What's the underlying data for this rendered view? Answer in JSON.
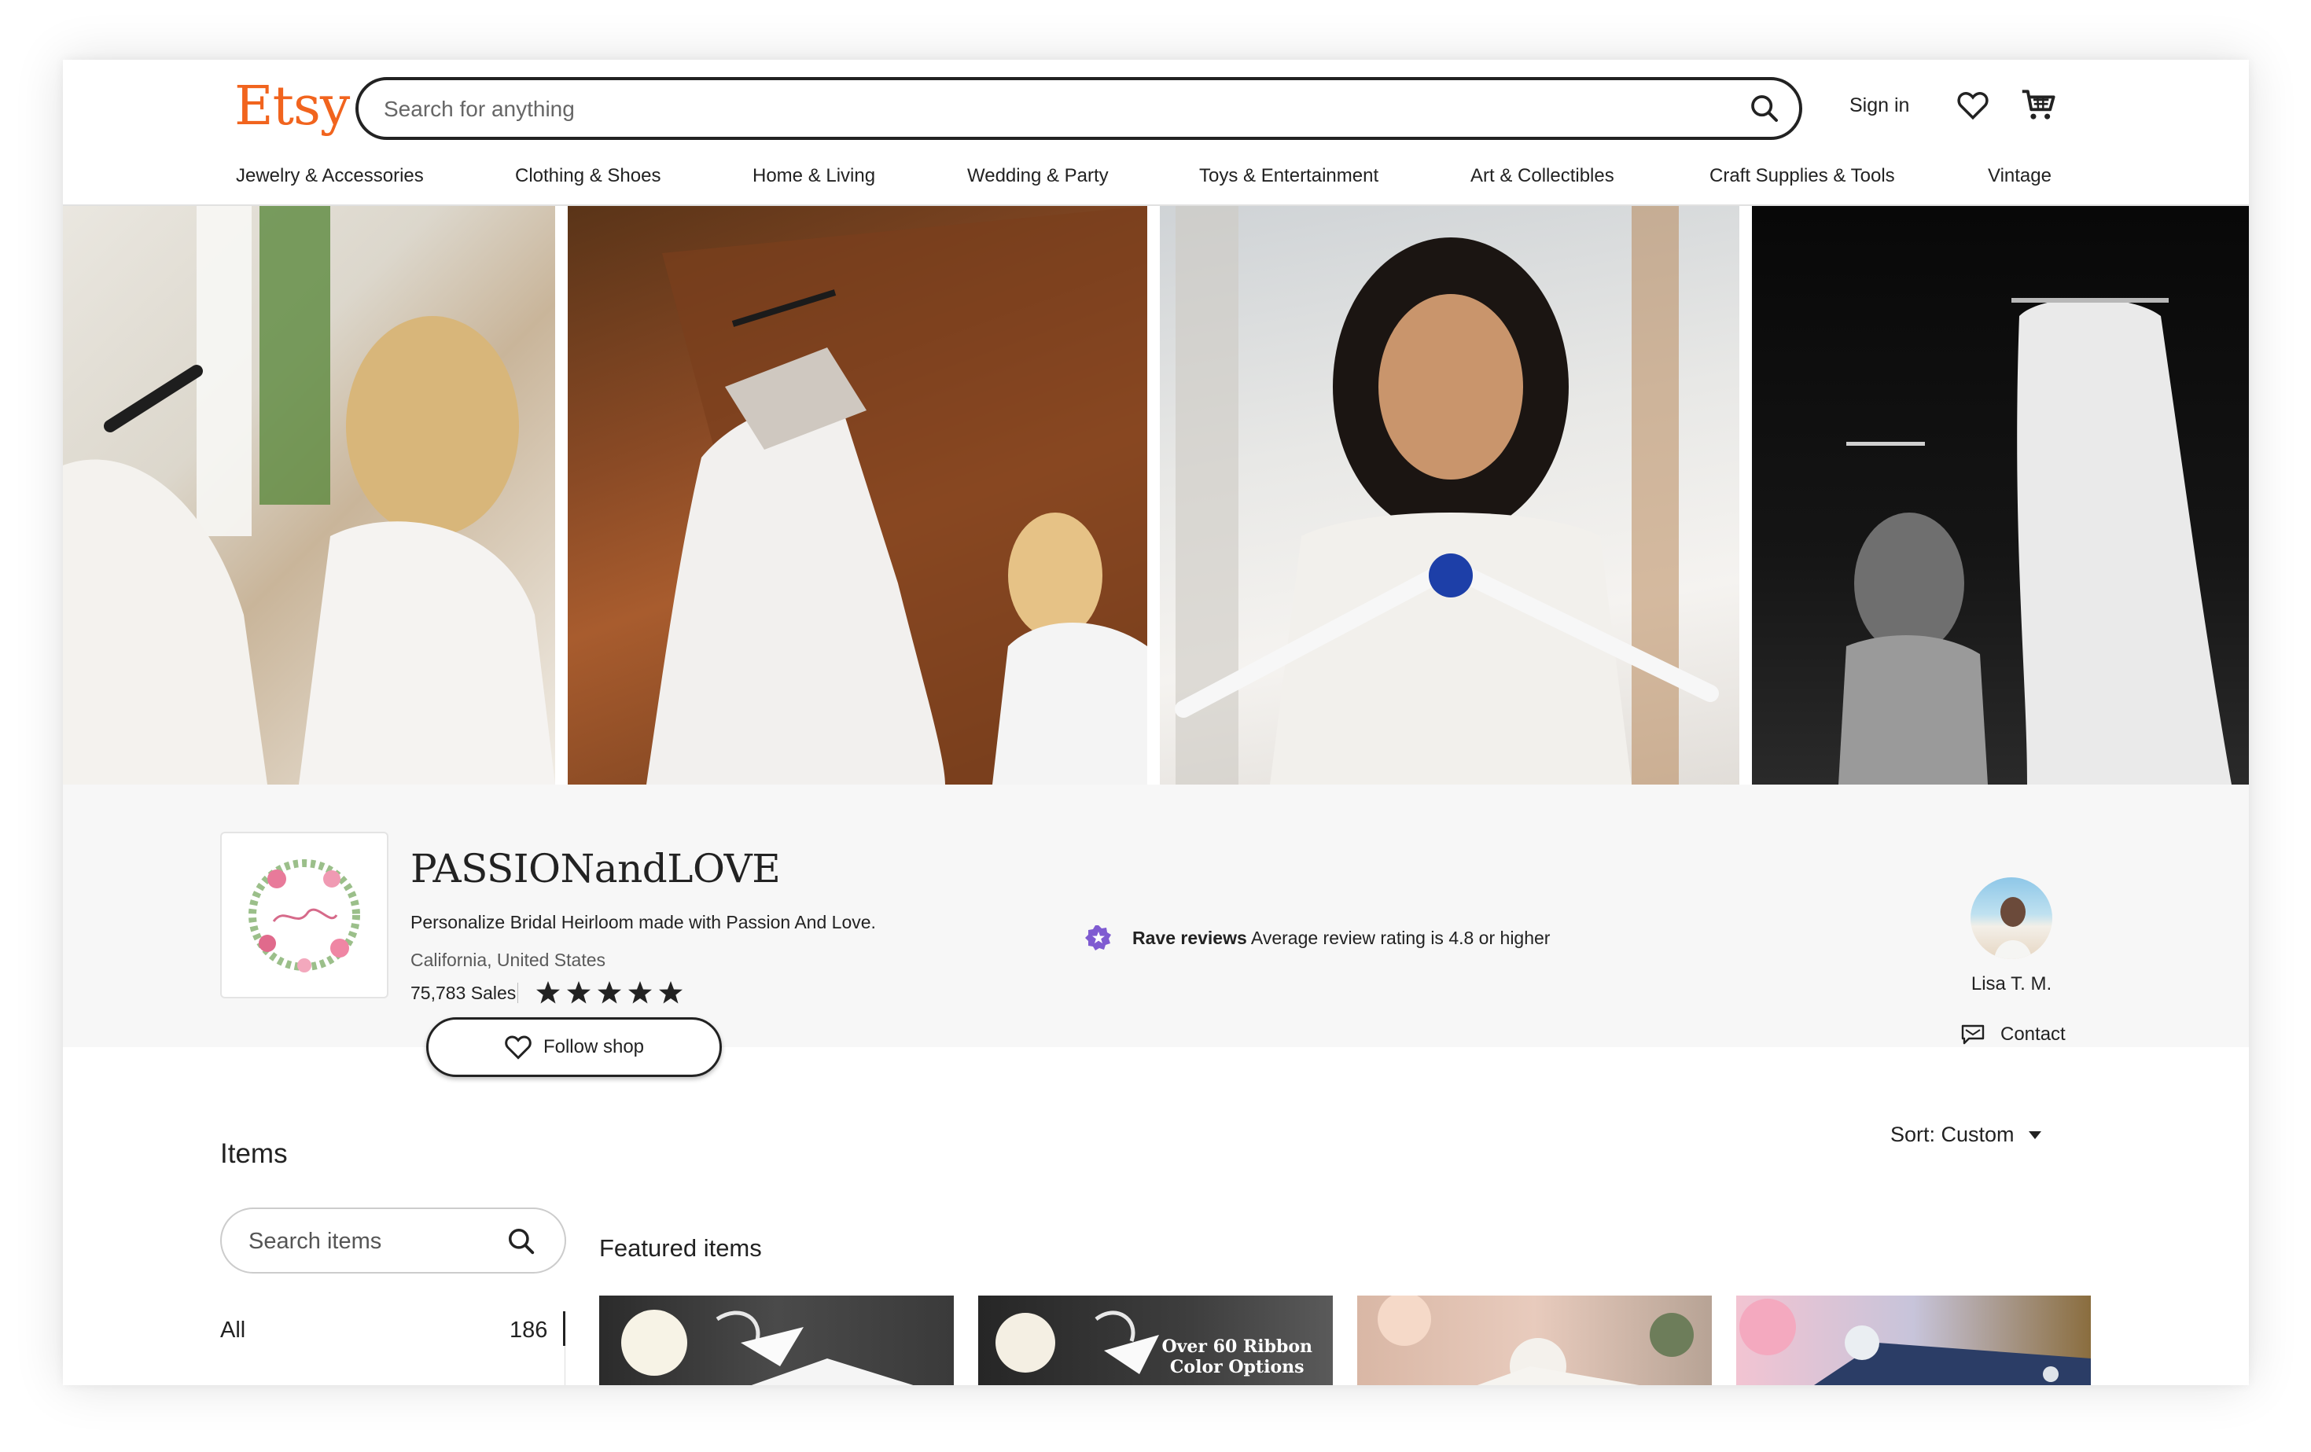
{
  "header": {
    "logo": "Etsy",
    "search_placeholder": "Search for anything",
    "sign_in": "Sign in",
    "nav": [
      "Jewelry & Accessories",
      "Clothing & Shoes",
      "Home & Living",
      "Wedding & Party",
      "Toys & Entertainment",
      "Art & Collectibles",
      "Craft Supplies & Tools",
      "Vintage"
    ]
  },
  "banner": {
    "images": [
      "bride-holding-hanger-photo",
      "wedding-dress-on-door-photo",
      "bride-holding-jeweled-hanger-photo",
      "black-white-dress-photo"
    ]
  },
  "shop": {
    "name": "PASSIONandLOVE",
    "tagline": "Personalize Bridal Heirloom made with Passion And Love.",
    "location": "California, United States",
    "sales": "75,783 Sales",
    "rating_stars": 5,
    "follow_label": "Follow shop",
    "rave_title": "Rave reviews",
    "rave_desc": "Average review rating is 4.8 or higher",
    "owner_name": "Lisa T. M.",
    "contact_label": "Contact"
  },
  "items": {
    "title": "Items",
    "sort_label": "Sort: Custom",
    "search_placeholder": "Search items",
    "categories": [
      {
        "label": "All",
        "count": "186"
      }
    ],
    "featured_title": "Featured items",
    "thumb_caption_line1": "Over 60 Ribbon",
    "thumb_caption_line2": "Color Options"
  },
  "colors": {
    "brand": "#f1641e",
    "text": "#222222",
    "muted": "#595959",
    "rave": "#7f5bd1",
    "panel": "#f7f7f7"
  }
}
